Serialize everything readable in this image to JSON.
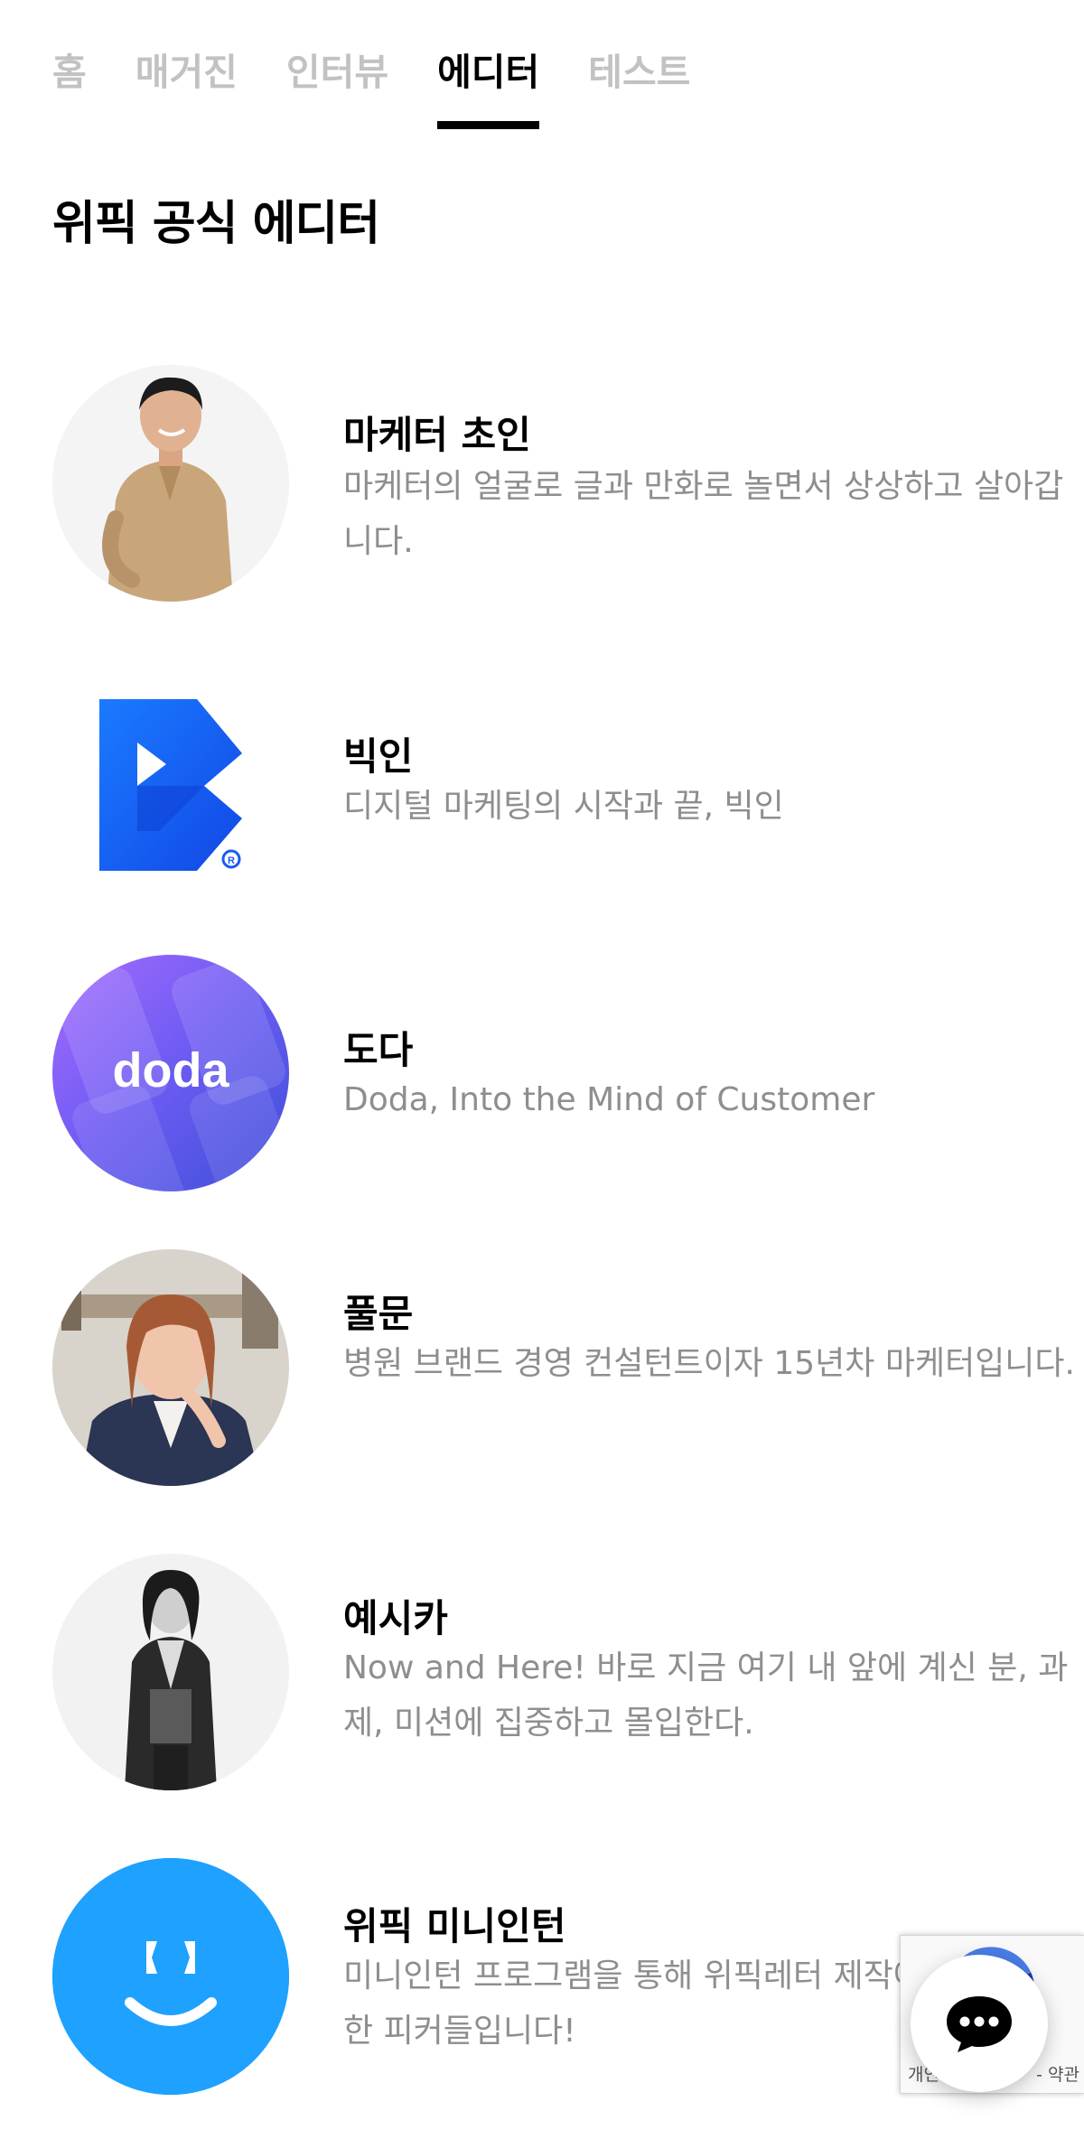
{
  "tabs": [
    {
      "label": "홈",
      "active": false
    },
    {
      "label": "매거진",
      "active": false
    },
    {
      "label": "인터뷰",
      "active": false
    },
    {
      "label": "에디터",
      "active": true
    },
    {
      "label": "테스트",
      "active": false
    }
  ],
  "page_title": "위픽 공식 에디터",
  "editors": [
    {
      "name": "마케터 초인",
      "description": "마케터의 얼굴로 글과 만화로 놀면서 상상하고 살아갑니다.",
      "avatar_icon": "person-photo"
    },
    {
      "name": "빅인",
      "description": "디지털 마케팅의 시작과 끝, 빅인",
      "avatar_icon": "bigin-logo"
    },
    {
      "name": "도다",
      "description": "Doda, Into the Mind of Customer",
      "avatar_icon": "doda-logo",
      "logo_text": "doda"
    },
    {
      "name": "풀문",
      "description": "병원 브랜드 경영 컨설턴트이자 15년차 마케터입니다.",
      "avatar_icon": "person-photo"
    },
    {
      "name": "예시카",
      "description": "Now and Here! 바로 지금 여기 내 앞에 계신 분, 과제, 미션에 집중하고 몰입한다.",
      "avatar_icon": "person-photo"
    },
    {
      "name": "위픽 미니인턴",
      "description": "미니인턴 프로그램을 통해 위픽레터 제작에 참여한 피커들입니다!",
      "avatar_icon": "smile-logo"
    }
  ],
  "recaptcha": {
    "privacy": "개인",
    "terms": "- 약관"
  },
  "chat": {
    "icon": "chat-bubble-icon"
  },
  "colors": {
    "active_tab": "#000000",
    "inactive_tab": "#c2c2c2",
    "description": "#8e8e8e",
    "bigin_blue": "#1a5cf2",
    "mini_intern_blue": "#1ea1ff"
  }
}
